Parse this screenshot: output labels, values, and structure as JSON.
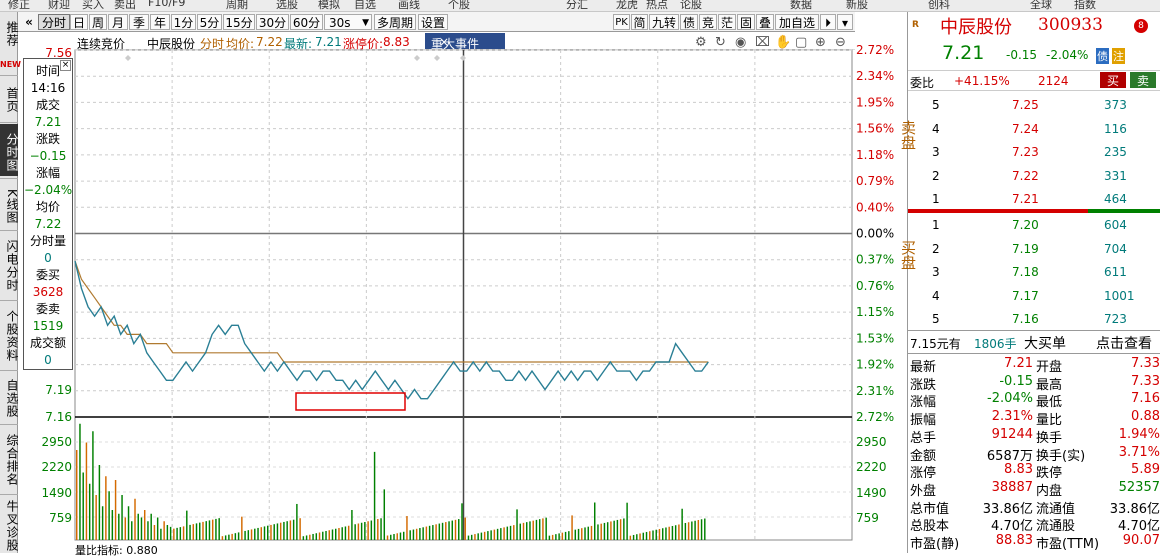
{
  "top_menu": [
    "修正",
    "财迎",
    "买入",
    "卖出",
    "F10/F9",
    "周期",
    "选股",
    "模拟",
    "自选",
    "画线",
    "个股",
    "",
    "分汇",
    "龙虎",
    "热点",
    "论股",
    "数据",
    "新股",
    "创科",
    "",
    "全球",
    "指数"
  ],
  "left_nav": [
    {
      "label": "推荐",
      "badge": "NEW",
      "active": false
    },
    {
      "label": "首页",
      "active": false
    },
    {
      "label": "分时图",
      "active": true
    },
    {
      "label": "K线图",
      "active": false
    },
    {
      "label": "闪电分时",
      "active": false
    },
    {
      "label": "个股资料",
      "active": false
    },
    {
      "label": "自选股",
      "active": false
    },
    {
      "label": "综合排名",
      "active": false
    },
    {
      "label": "牛叉诊股",
      "active": false
    }
  ],
  "toolbar": {
    "prev_btn": "«",
    "tabs": [
      "分时",
      "日",
      "周",
      "月",
      "季",
      "年",
      "1分",
      "5分",
      "15分",
      "30分",
      "60分"
    ],
    "interval": "30s",
    "multi_period": "多周期",
    "settings": "设置",
    "right_tabs": [
      "PK",
      "简",
      "九转",
      "债",
      "竞",
      "茫",
      "固",
      "叠",
      "加自选"
    ],
    "expand": "⏵",
    "more": "▾"
  },
  "chart_header": {
    "auction_label": "连续竞价",
    "stock_name": "中辰股份",
    "mode": "分时",
    "avg_label": "均价:",
    "avg_value": "7.22",
    "last_label": "最新:",
    "last_value": "7.21",
    "limit_label": "涨停价:",
    "limit_value": "8.83",
    "event_tab": "重大事件",
    "event_close": "×"
  },
  "time_panel": {
    "time_label": "时间",
    "time_value": "14:16",
    "trade_label": "成交",
    "trade_value": "7.21",
    "change_label": "涨跌",
    "change_value": "−0.15",
    "pct_label": "涨幅",
    "pct_value": "−2.04%",
    "avg_label": "均价",
    "avg_value": "7.22",
    "minute_vol_label": "分时量",
    "minute_vol_value": "0",
    "bid_label": "委买",
    "bid_value": "3628",
    "ask_label": "委卖",
    "ask_value": "1519",
    "amount_label": "成交额",
    "amount_value": "0",
    "close_icon": "×"
  },
  "chart_data": {
    "type": "line",
    "price_axis_left": [
      "7.56",
      "7.19",
      "7.16"
    ],
    "pct_axis_right": [
      "2.72%",
      "2.34%",
      "1.95%",
      "1.56%",
      "1.18%",
      "0.79%",
      "0.40%",
      "0.00%",
      "0.37%",
      "0.76%",
      "1.15%",
      "1.53%",
      "1.92%",
      "2.31%",
      "2.72%"
    ],
    "volume_axis": [
      "2950",
      "2220",
      "1490",
      "759"
    ],
    "volume_axis_right": [
      "2950",
      "2220",
      "1490",
      "759"
    ],
    "bottom_label": "量比指标: 0.880",
    "price_series": [
      7.33,
      7.3,
      7.28,
      7.27,
      7.28,
      7.26,
      7.27,
      7.25,
      7.26,
      7.24,
      7.25,
      7.23,
      7.22,
      7.21,
      7.2,
      7.2,
      7.21,
      7.22,
      7.21,
      7.22,
      7.23,
      7.25,
      7.26,
      7.25,
      7.26,
      7.26,
      7.24,
      7.23,
      7.22,
      7.21,
      7.22,
      7.21,
      7.22,
      7.21,
      7.2,
      7.21,
      7.21,
      7.2,
      7.21,
      7.21,
      7.2,
      7.2,
      7.19,
      7.2,
      7.19,
      7.2,
      7.21,
      7.2,
      7.19,
      7.2,
      7.19,
      7.18,
      7.19,
      7.18,
      7.18,
      7.19,
      7.2,
      7.21,
      7.22,
      7.21,
      7.21,
      7.22,
      7.21,
      7.22,
      7.21,
      7.21,
      7.2,
      7.2,
      7.21,
      7.2,
      7.21,
      7.2,
      7.19,
      7.2,
      7.21,
      7.2,
      7.21,
      7.2,
      7.21,
      7.21,
      7.2,
      7.21,
      7.22,
      7.21,
      7.21,
      7.21,
      7.2,
      7.21,
      7.21,
      7.22,
      7.22,
      7.22,
      7.24,
      7.23,
      7.22,
      7.21,
      7.21,
      7.22
    ],
    "avg_series": [
      7.33,
      7.31,
      7.3,
      7.29,
      7.28,
      7.27,
      7.26,
      7.26,
      7.25,
      7.25,
      7.25,
      7.24,
      7.24,
      7.24,
      7.24,
      7.23,
      7.23,
      7.23,
      7.23,
      7.23,
      7.23,
      7.23,
      7.23,
      7.23,
      7.23,
      7.23,
      7.23,
      7.23,
      7.23,
      7.23,
      7.23,
      7.23,
      7.22,
      7.22,
      7.22,
      7.22,
      7.22,
      7.22,
      7.22,
      7.22,
      7.22,
      7.22,
      7.22,
      7.22,
      7.22,
      7.22,
      7.22,
      7.22,
      7.22,
      7.22,
      7.22,
      7.22,
      7.22,
      7.22,
      7.22,
      7.22,
      7.22,
      7.22,
      7.22,
      7.22,
      7.22,
      7.22,
      7.22,
      7.22,
      7.22,
      7.22,
      7.22,
      7.22,
      7.22,
      7.22,
      7.22,
      7.22,
      7.22,
      7.22,
      7.22,
      7.22,
      7.22,
      7.22,
      7.22,
      7.22,
      7.22,
      7.22,
      7.22,
      7.22,
      7.22,
      7.22,
      7.22,
      7.22,
      7.22,
      7.22,
      7.22,
      7.22,
      7.22,
      7.22,
      7.22,
      7.22,
      7.22,
      7.22
    ],
    "ylim": [
      7.16,
      7.56
    ],
    "prev_close": 7.36,
    "volume_ylim": [
      0,
      3200
    ]
  },
  "right_panel": {
    "logo": "R",
    "name": "中辰股份",
    "code": "300933",
    "badge": "8",
    "price": "7.21",
    "change": "-0.15",
    "pct": "-2.04%",
    "tag1": "债",
    "tag2": "注",
    "weibi_label": "委比",
    "weibi_value": "+41.15%",
    "weicha_value": "2124",
    "buy_btn": "买",
    "sell_btn": "卖",
    "sell_label": "卖盘",
    "buy_label": "买盘",
    "sell_orders": [
      {
        "level": "5",
        "price": "7.25",
        "vol": "373"
      },
      {
        "level": "4",
        "price": "7.24",
        "vol": "116"
      },
      {
        "level": "3",
        "price": "7.23",
        "vol": "235"
      },
      {
        "level": "2",
        "price": "7.22",
        "vol": "331"
      },
      {
        "level": "1",
        "price": "7.21",
        "vol": "464"
      }
    ],
    "buy_orders": [
      {
        "level": "1",
        "price": "7.20",
        "vol": "604"
      },
      {
        "level": "2",
        "price": "7.19",
        "vol": "704"
      },
      {
        "level": "3",
        "price": "7.18",
        "vol": "611"
      },
      {
        "level": "4",
        "price": "7.17",
        "vol": "1001"
      },
      {
        "level": "5",
        "price": "7.16",
        "vol": "723"
      }
    ],
    "big_order": {
      "price": "7.15元有",
      "qty": "1806手",
      "label": "大买单",
      "link": "点击查看"
    },
    "stats": [
      {
        "l1": "最新",
        "v1": "7.21",
        "l2": "开盘",
        "v2": "7.33"
      },
      {
        "l1": "涨跌",
        "v1": "-0.15",
        "l2": "最高",
        "v2": "7.33"
      },
      {
        "l1": "涨幅",
        "v1": "-2.04%",
        "l2": "最低",
        "v2": "7.16"
      },
      {
        "l1": "振幅",
        "v1": "2.31%",
        "l2": "量比",
        "v2": "0.88"
      },
      {
        "l1": "总手",
        "v1": "91244",
        "l2": "换手",
        "v2": "1.94%"
      },
      {
        "l1": "金额",
        "v1": "6587万",
        "l2": "换手(实)",
        "v2": "3.71%"
      },
      {
        "l1": "涨停",
        "v1": "8.83",
        "l2": "跌停",
        "v2": "5.89"
      },
      {
        "l1": "外盘",
        "v1": "38887",
        "l2": "内盘",
        "v2": "52357"
      },
      {
        "l1": "总市值",
        "v1": "33.86亿",
        "l2": "流通值",
        "v2": "33.86亿"
      },
      {
        "l1": "总股本",
        "v1": "4.70亿",
        "l2": "流通股",
        "v2": "4.70亿"
      },
      {
        "l1": "市盈(静)",
        "v1": "88.83",
        "l2": "市盈(TTM)",
        "v2": "90.07"
      }
    ]
  },
  "colors": {
    "up": "#d40000",
    "down": "#008000",
    "price_line": "#2a7f95",
    "avg_line": "#b07a30",
    "volume": "#008000",
    "highlight_box": "#e00000"
  }
}
